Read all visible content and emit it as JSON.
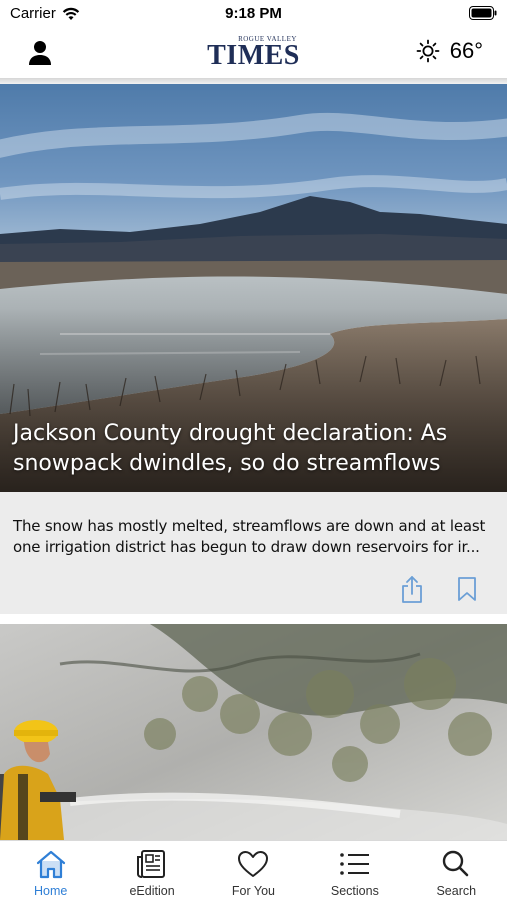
{
  "status_bar": {
    "carrier": "Carrier",
    "time": "9:18 PM"
  },
  "header": {
    "logo_small": "ROGUE VALLEY",
    "logo_big": "TIMES",
    "temperature": "66°"
  },
  "articles": [
    {
      "headline": "Jackson County drought declaration: As snowpack dwindles, so do streamflows",
      "summary": "The snow has mostly melted, streamflows are down and at least one irrigation district has begun to draw down reservoirs for ir..."
    }
  ],
  "tab_bar": {
    "items": [
      {
        "label": "Home",
        "icon": "home-icon",
        "active": true
      },
      {
        "label": "eEdition",
        "icon": "newspaper-icon",
        "active": false
      },
      {
        "label": "For You",
        "icon": "heart-icon",
        "active": false
      },
      {
        "label": "Sections",
        "icon": "list-icon",
        "active": false
      },
      {
        "label": "Search",
        "icon": "search-icon",
        "active": false
      }
    ]
  },
  "colors": {
    "accent": "#2f7fd6",
    "logo": "#1f2e57",
    "card_background": "#ececec"
  }
}
